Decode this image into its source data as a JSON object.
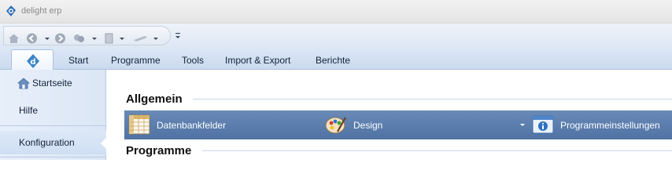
{
  "window": {
    "title": "delight erp",
    "app_icon": "delight-puzzle-icon"
  },
  "quick_access": {
    "icons": [
      "home-icon",
      "back-icon",
      "forward-icon",
      "network-icon",
      "document-icon",
      "pen-icon"
    ],
    "more_icon": "chevron-down-icon"
  },
  "ribbon": {
    "app_button_icon": "delight-logo-icon",
    "tabs": [
      {
        "label": "Start"
      },
      {
        "label": "Programme"
      },
      {
        "label": "Tools"
      },
      {
        "label": "Import & Export"
      },
      {
        "label": "Berichte"
      }
    ]
  },
  "sidebar": {
    "items": [
      {
        "label": "Startseite",
        "icon": "home-icon"
      },
      {
        "label": "Hilfe"
      },
      {
        "label": "Konfiguration",
        "selected": true
      }
    ]
  },
  "main": {
    "sections": [
      {
        "title": "Allgemein",
        "items": [
          {
            "label": "Datenbankfelder",
            "icon": "table-grid-icon"
          },
          {
            "label": "Design",
            "icon": "palette-icon"
          },
          {
            "label": "Programmeinstellungen",
            "icon": "settings-window-icon"
          }
        ]
      },
      {
        "title": "Programme"
      }
    ]
  },
  "colors": {
    "group_bar": "#5577aa",
    "tab_strip": "#cbdaef",
    "sidebar": "#dfe9f7",
    "accent": "#2f6fb5"
  }
}
